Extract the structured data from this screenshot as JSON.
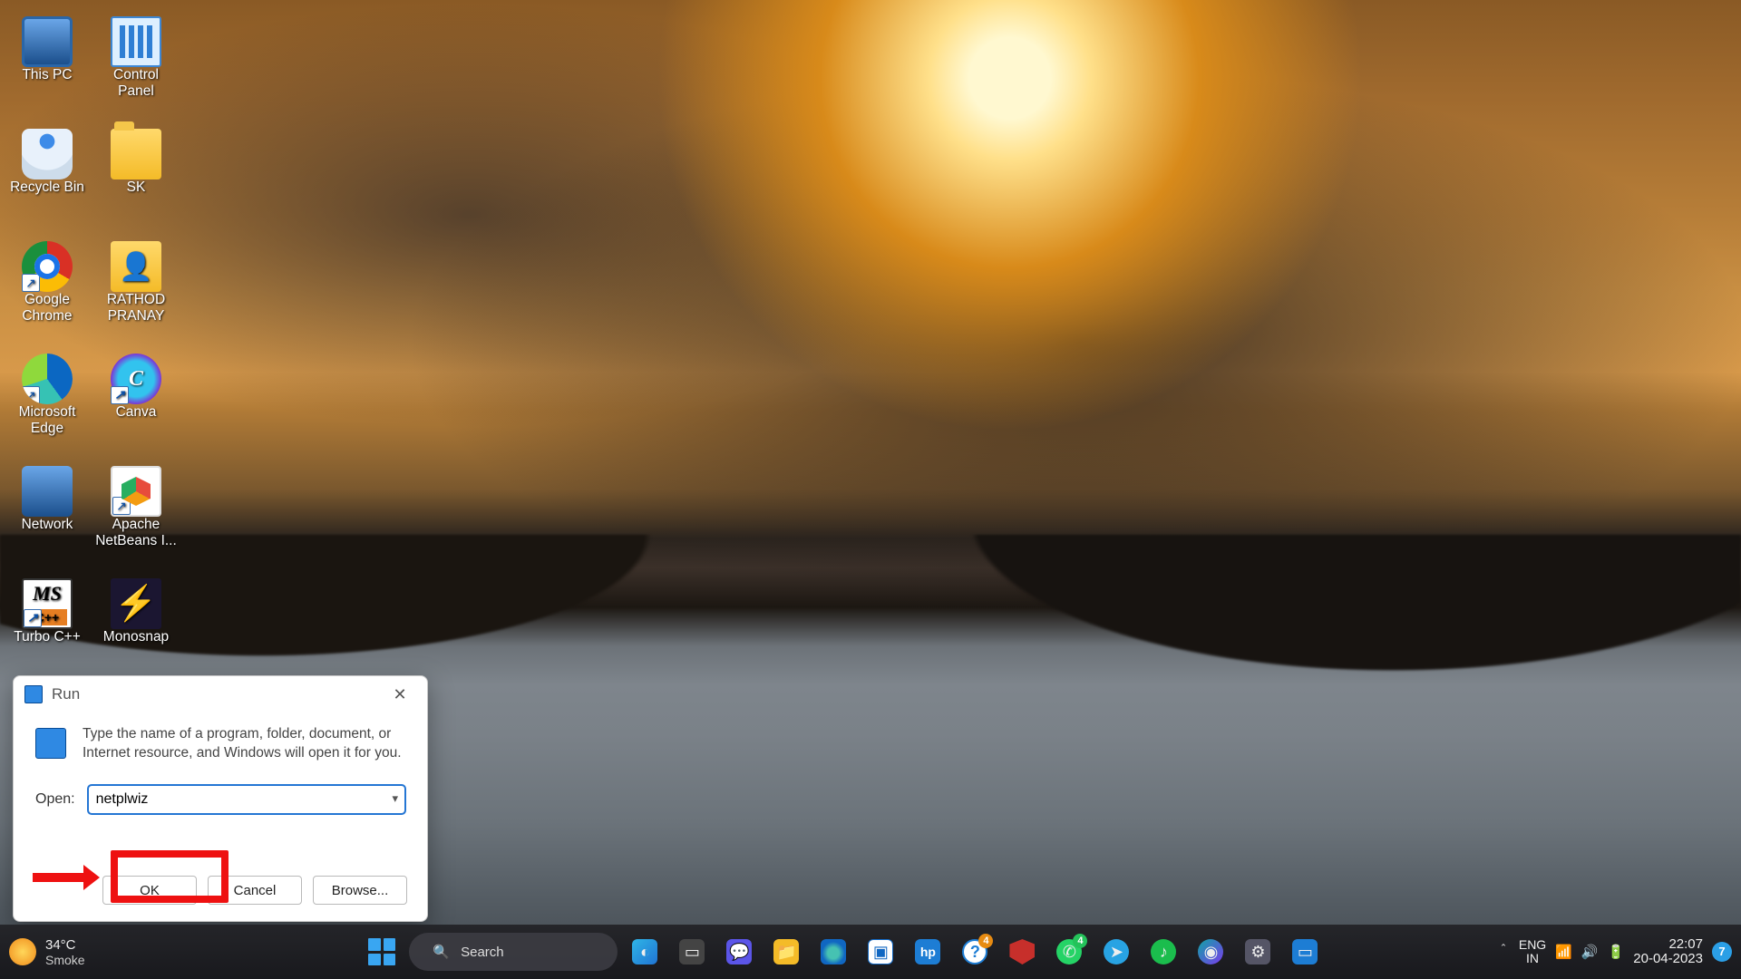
{
  "desktop": {
    "icons": [
      {
        "label": "This PC"
      },
      {
        "label": "Control Panel"
      },
      {
        "label": "Recycle Bin"
      },
      {
        "label": "SK"
      },
      {
        "label": "Google Chrome"
      },
      {
        "label": "RATHOD PRANAY"
      },
      {
        "label": "Microsoft Edge"
      },
      {
        "label": "Canva"
      },
      {
        "label": "Network"
      },
      {
        "label": "Apache NetBeans I..."
      },
      {
        "label": "Turbo C++"
      },
      {
        "label": "Monosnap"
      }
    ]
  },
  "run_dialog": {
    "title": "Run",
    "description": "Type the name of a program, folder, document, or Internet resource, and Windows will open it for you.",
    "open_label": "Open:",
    "open_value": "netplwiz",
    "buttons": {
      "ok": "OK",
      "cancel": "Cancel",
      "browse": "Browse..."
    }
  },
  "taskbar": {
    "weather": {
      "temp": "34°C",
      "cond": "Smoke"
    },
    "search_placeholder": "Search",
    "badges": {
      "hp_q": "4",
      "whatsapp": "4"
    },
    "systray": {
      "lang_top": "ENG",
      "lang_bot": "IN",
      "time": "22:07",
      "date": "20-04-2023",
      "notif_count": "7"
    }
  },
  "annotation": {
    "target": "run-ok-button"
  }
}
